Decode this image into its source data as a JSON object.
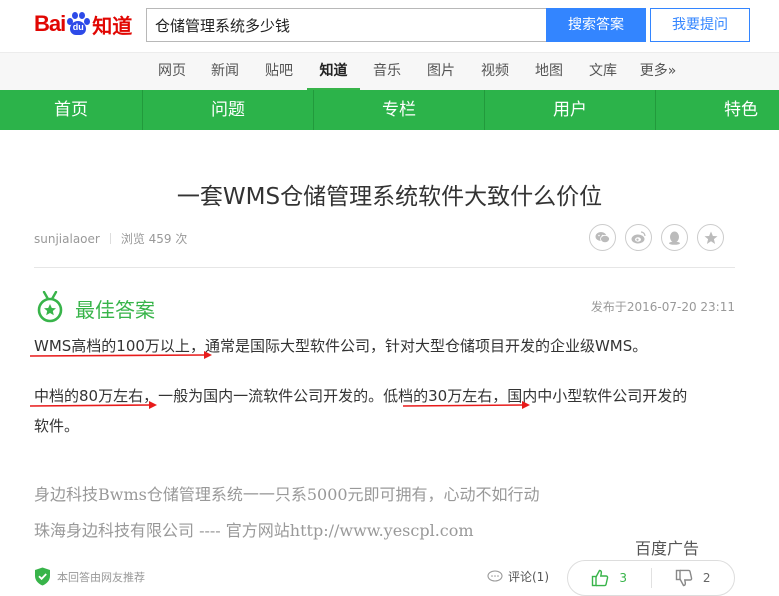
{
  "logo": {
    "bai": "Bai",
    "du": "du",
    "zhidao": "知道"
  },
  "search": {
    "value": "仓储管理系统多少钱",
    "button": "搜索答案",
    "ask": "我要提问"
  },
  "channels": [
    "网页",
    "新闻",
    "贴吧",
    "知道",
    "音乐",
    "图片",
    "视频",
    "地图",
    "文库",
    "更多»"
  ],
  "active_channel": "知道",
  "nav": [
    "首页",
    "问题",
    "专栏",
    "用户",
    "特色"
  ],
  "question": {
    "title": "一套WMS仓储管理系统软件大致什么价位",
    "author": "sunjialaoer",
    "views": "浏览 459 次"
  },
  "share_icons": [
    "wechat-icon",
    "weibo-icon",
    "qq-icon",
    "qzone-icon"
  ],
  "answer": {
    "label": "最佳答案",
    "date": "发布于2016-07-20 23:11",
    "p1_a": "WMS高档的100万以上",
    "p1_b": "，通常是国际大型软件公司，针对大型仓储项目开发的企业级WMS。",
    "p2_a": "中档的80万左右",
    "p2_b": "，一般为国内一流软件公司开发的。",
    "p2_c": "低档的30万左右",
    "p2_d": "，国内中小型软件公司开发的",
    "p2_e": "软件。"
  },
  "ad": {
    "line1": "身边科技Bwms仓储管理系统一一只系5000元即可拥有，心动不如行动",
    "line2": "珠海身边科技有限公司 ---- 官方网站http://www.yescpl.com",
    "label": "百度广告"
  },
  "footer": {
    "recommend": "本回答由网友推荐",
    "comment": "评论(1)",
    "likes": "3",
    "dislikes": "2"
  },
  "colors": {
    "brand_green": "#2cb34a",
    "search_blue": "#3385ff",
    "logo_red": "#e10602",
    "underline_red": "#e81b1b"
  }
}
